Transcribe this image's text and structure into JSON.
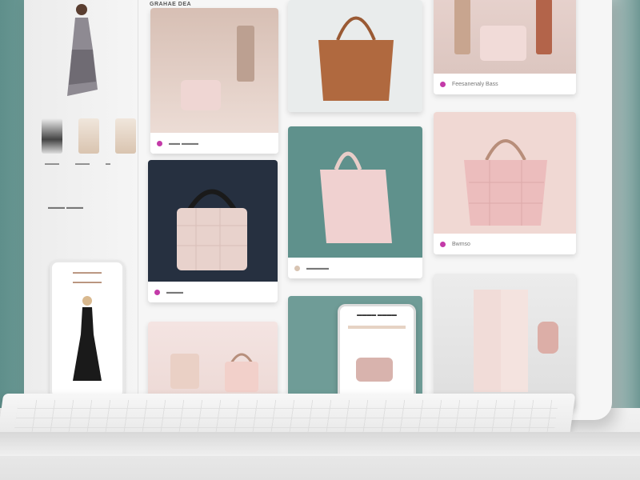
{
  "header": {
    "title": "GRAHAE DEA"
  },
  "side_panel": {
    "mini_labels": [
      "▬▬▬",
      "▬▬▬",
      "▬"
    ],
    "label": "▬▬▬ ▬▬▬",
    "phone_text_1": "▬▬▬▬▬▬",
    "phone_text_2": "▬▬▬▬▬▬"
  },
  "tiles": [
    {
      "caption": "▬▬ ▬▬▬"
    },
    {
      "caption": ""
    },
    {
      "caption": "Feesanenaly Bass"
    },
    {
      "caption": ""
    },
    {
      "caption": ""
    },
    {
      "caption": "Bwmso"
    },
    {
      "caption": "▬▬▬"
    },
    {
      "caption": "▬▬▬▬"
    },
    {
      "caption": ""
    }
  ],
  "phone_mid": {
    "title": "▬▬▬▬ ▬▬▬▬"
  },
  "colors": {
    "accent": "#c33aa8",
    "teal": "#6f9c97",
    "blush": "#f0d8d3"
  }
}
